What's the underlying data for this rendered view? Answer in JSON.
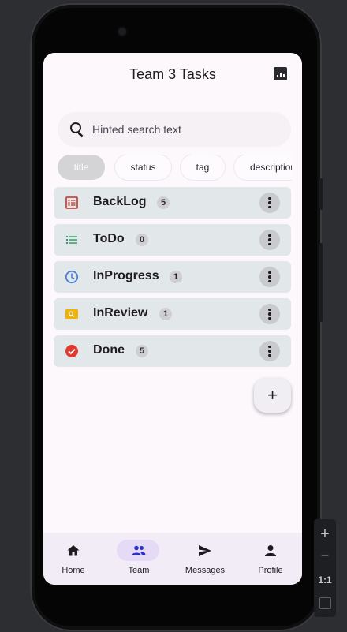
{
  "app": {
    "title": "Team 3 Tasks",
    "title_icon": "bar-chart-icon"
  },
  "search": {
    "placeholder": "Hinted search text",
    "icon": "search-icon"
  },
  "filter_chips": [
    {
      "label": "title",
      "selected": true
    },
    {
      "label": "status",
      "selected": false
    },
    {
      "label": "tag",
      "selected": false
    },
    {
      "label": "description",
      "selected": false
    }
  ],
  "groups": [
    {
      "label": "BackLog",
      "count": "5",
      "icon": "backlog-list-icon",
      "color": "#c9483f"
    },
    {
      "label": "ToDo",
      "count": "0",
      "icon": "checklist-icon",
      "color": "#2e9e62"
    },
    {
      "label": "InProgress",
      "count": "1",
      "icon": "clock-icon",
      "color": "#4a7fd6"
    },
    {
      "label": "InReview",
      "count": "1",
      "icon": "review-search-icon",
      "color": "#f0b400"
    },
    {
      "label": "Done",
      "count": "5",
      "icon": "check-circle-icon",
      "color": "#e03a2f"
    }
  ],
  "fab": {
    "label": "+",
    "icon": "add-icon"
  },
  "bottom_nav": [
    {
      "label": "Home",
      "icon": "home-icon",
      "active": false
    },
    {
      "label": "Team",
      "icon": "team-icon",
      "active": true
    },
    {
      "label": "Messages",
      "icon": "send-icon",
      "active": false
    },
    {
      "label": "Profile",
      "icon": "person-icon",
      "active": false
    }
  ],
  "emulator_controls": {
    "zoom_in": "+",
    "zoom_out": "−",
    "actual_size": "1:1"
  },
  "colors": {
    "accent": "#e5dbf6",
    "row_background": "#e2e7ea",
    "team_icon": "#2b2fc7"
  }
}
